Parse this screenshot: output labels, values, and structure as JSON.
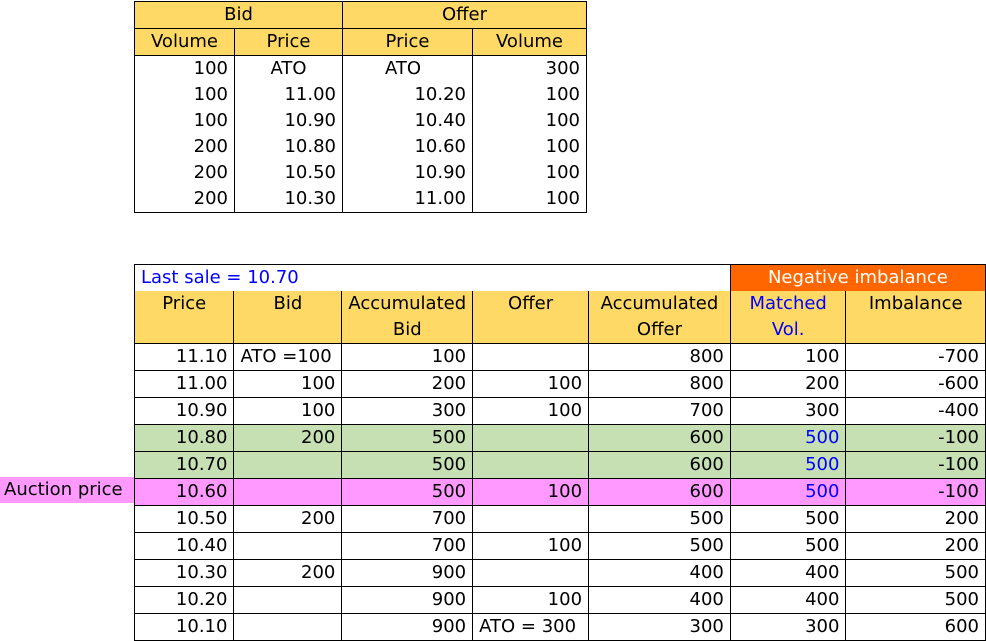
{
  "bid_offer_table": {
    "group_headers": [
      "Bid",
      "Offer"
    ],
    "column_headers": [
      "Volume",
      "Price",
      "Price",
      "Volume"
    ],
    "rows": [
      [
        "100",
        "ATO",
        "ATO",
        "300"
      ],
      [
        "100",
        "11.00",
        "10.20",
        "100"
      ],
      [
        "100",
        "10.90",
        "10.40",
        "100"
      ],
      [
        "200",
        "10.80",
        "10.60",
        "100"
      ],
      [
        "200",
        "10.50",
        "10.90",
        "100"
      ],
      [
        "200",
        "10.30",
        "11.00",
        "100"
      ]
    ]
  },
  "auction_table": {
    "last_sale": "Last sale = 10.70",
    "banner": "Negative imbalance",
    "column_headers": [
      [
        "Price"
      ],
      [
        "Bid"
      ],
      [
        "Accumulated",
        "Bid"
      ],
      [
        "Offer"
      ],
      [
        "Accumulated",
        "Offer"
      ],
      [
        "Matched",
        "Vol."
      ],
      [
        "Imbalance"
      ]
    ],
    "rows": [
      [
        "11.10",
        "ATO =100",
        "100",
        "",
        "800",
        "100",
        "-700"
      ],
      [
        "11.00",
        "100",
        "200",
        "100",
        "800",
        "200",
        "-600"
      ],
      [
        "10.90",
        "100",
        "300",
        "100",
        "700",
        "300",
        "-400"
      ],
      [
        "10.80",
        "200",
        "500",
        "",
        "600",
        "500",
        "-100"
      ],
      [
        "10.70",
        "",
        "500",
        "",
        "600",
        "500",
        "-100"
      ],
      [
        "10.60",
        "",
        "500",
        "100",
        "600",
        "500",
        "-100"
      ],
      [
        "10.50",
        "200",
        "700",
        "",
        "500",
        "500",
        "200"
      ],
      [
        "10.40",
        "",
        "700",
        "100",
        "500",
        "500",
        "200"
      ],
      [
        "10.30",
        "200",
        "900",
        "",
        "400",
        "400",
        "500"
      ],
      [
        "10.20",
        "",
        "900",
        "100",
        "400",
        "400",
        "500"
      ],
      [
        "10.10",
        "",
        "900",
        "ATO = 300",
        "300",
        "300",
        "600"
      ]
    ],
    "row_highlights": [
      "",
      "",
      "",
      "green",
      "green",
      "pink",
      "",
      "",
      "",
      "",
      ""
    ],
    "blue_matched_rows": [
      3,
      4,
      5
    ]
  },
  "side_label": "Auction price",
  "colors": {
    "header": "#ffd966",
    "highlight_green": "#c6e0b4",
    "highlight_pink": "#ff99ff",
    "banner_orange": "#ff6600",
    "blue_text": "#0000ff"
  }
}
